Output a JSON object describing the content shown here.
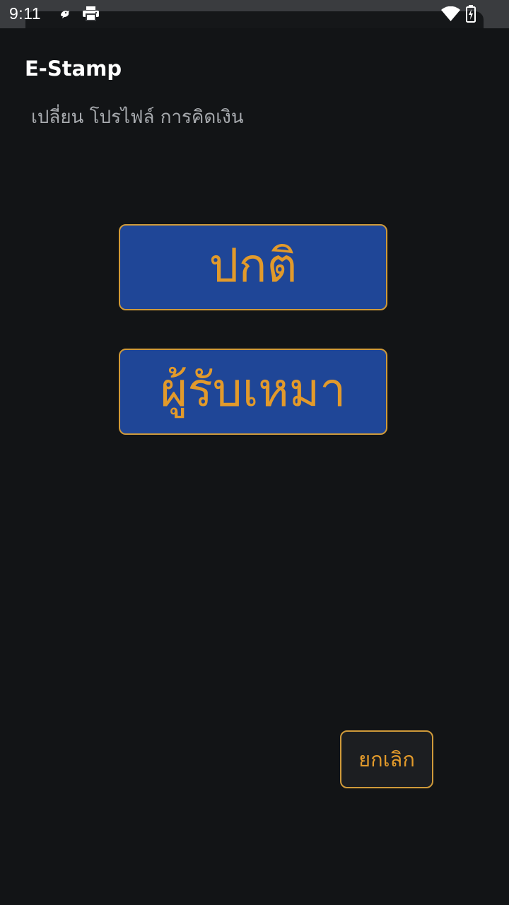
{
  "status_bar": {
    "time": "9:11",
    "icons": [
      "notification-icon",
      "print-icon",
      "wifi-icon",
      "battery-charging-icon"
    ]
  },
  "header": {
    "title": "E-Stamp",
    "subtitle": "เปลี่ยน โปรไฟล์ การคิดเงิน"
  },
  "options": {
    "normal_label": "ปกติ",
    "contractor_label": "ผู้รับเหมา"
  },
  "footer": {
    "cancel_label": "ยกเลิก"
  },
  "colors": {
    "background": "#121416",
    "button_fill": "#1f4697",
    "accent_text": "#e29a2b",
    "border": "#cf9a3a"
  }
}
